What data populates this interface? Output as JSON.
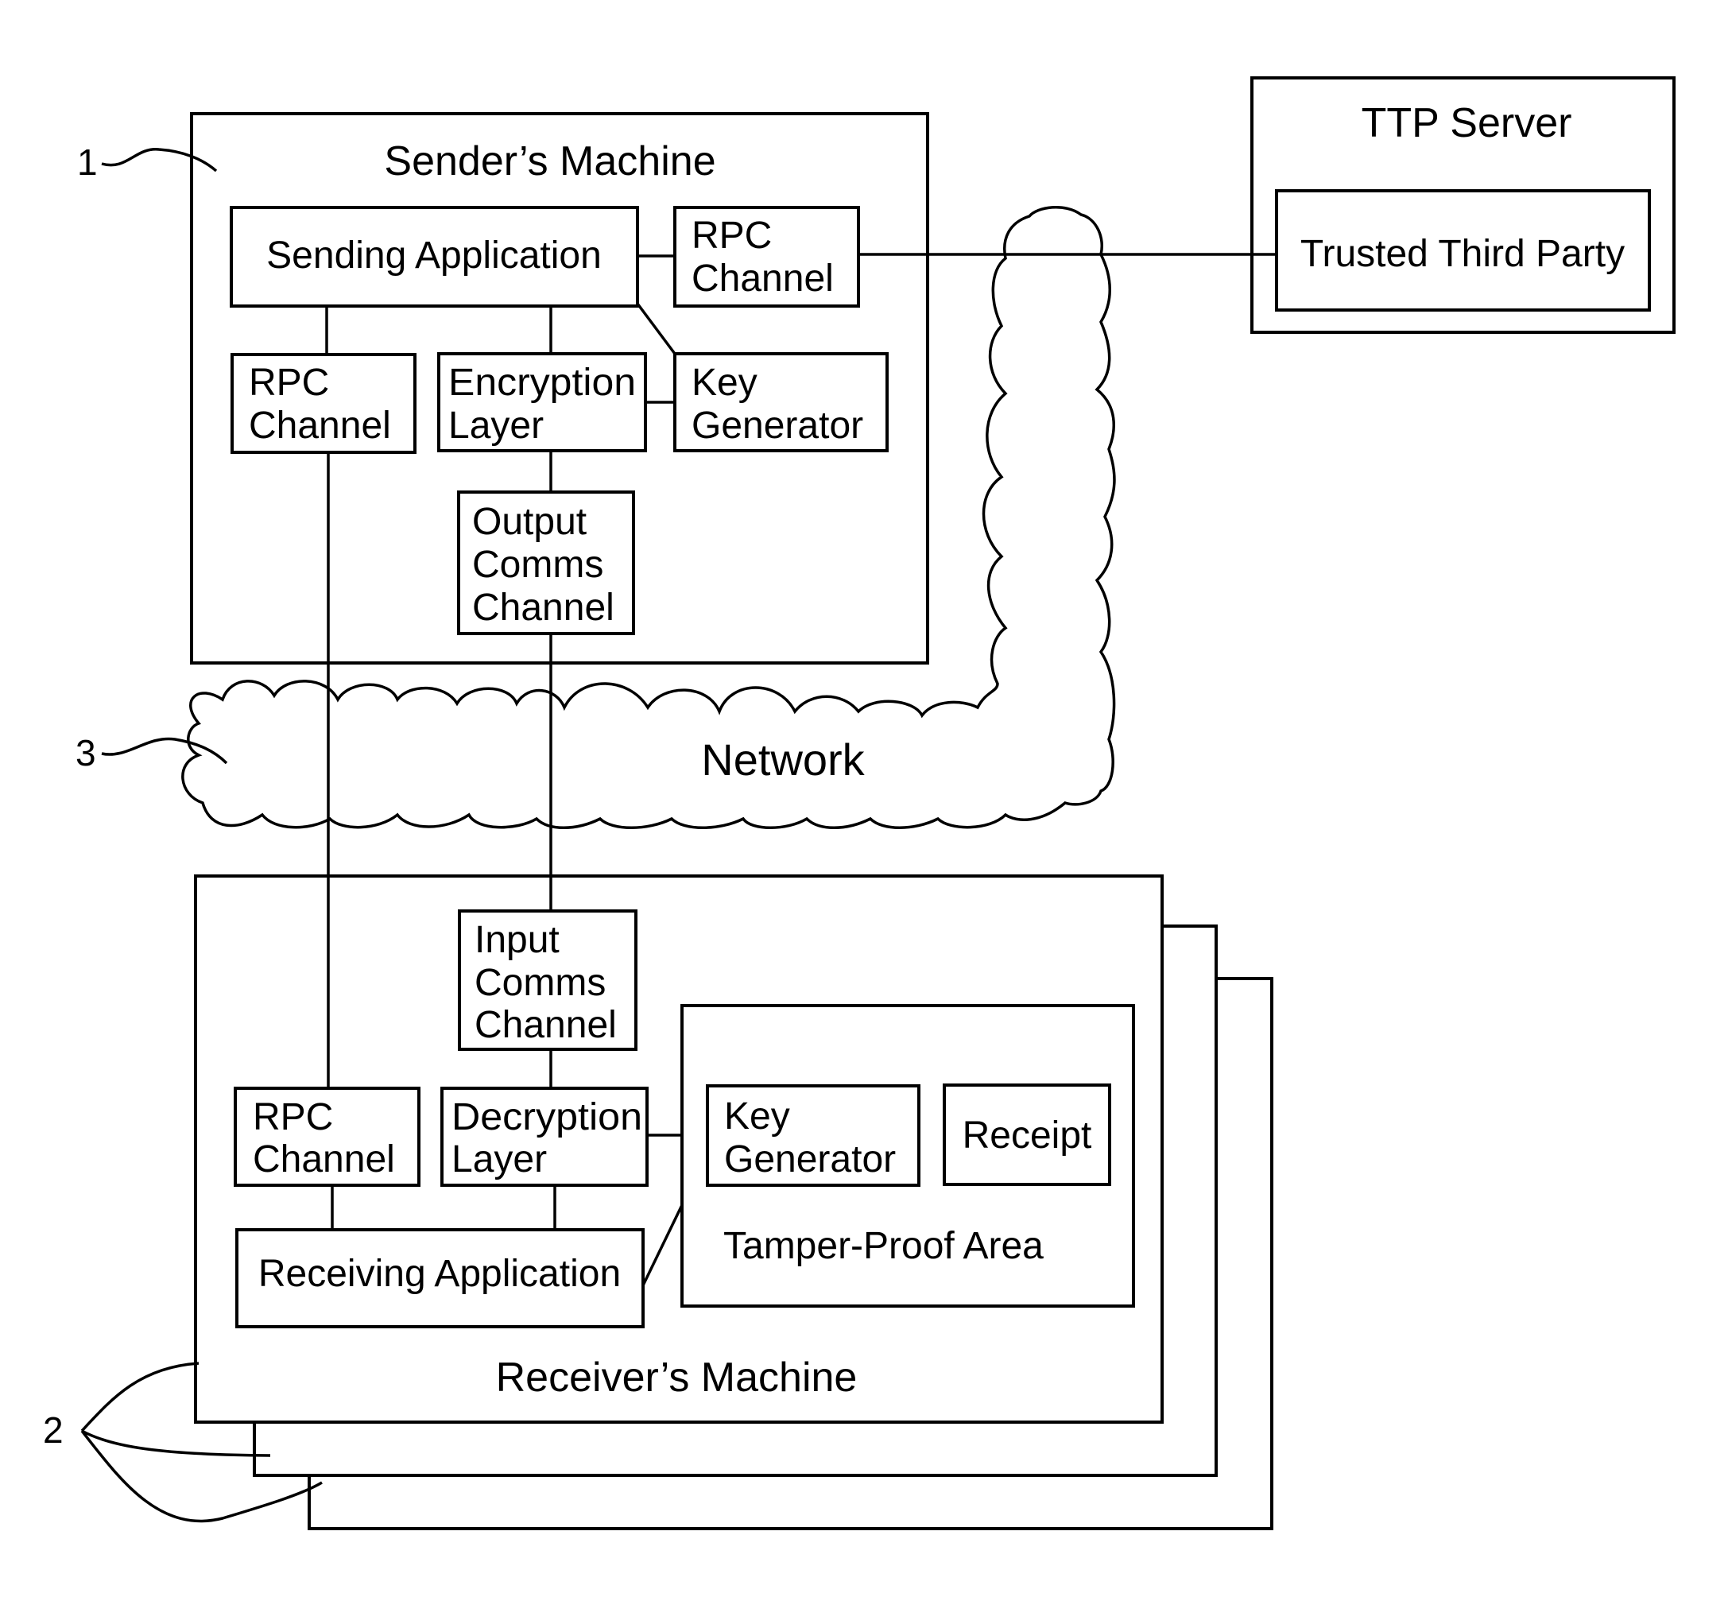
{
  "diagram": {
    "type": "block-diagram",
    "reference_numerals": {
      "sender": "1",
      "receivers": "2",
      "network": "3"
    },
    "sender_machine": {
      "title": "Sender’s Machine",
      "blocks": {
        "sending_application": "Sending Application",
        "rpc_channel_top_l1": "RPC",
        "rpc_channel_top_l2": "Channel",
        "rpc_channel_l1": "RPC",
        "rpc_channel_l2": "Channel",
        "encryption_l1": "Encryption",
        "encryption_l2": "Layer",
        "key_generator_l1": "Key",
        "key_generator_l2": "Generator",
        "output_l1": "Output",
        "output_l2": "Comms",
        "output_l3": "Channel"
      }
    },
    "ttp_server": {
      "title": "TTP Server",
      "trusted_third_party": "Trusted Third Party"
    },
    "network": {
      "label": "Network"
    },
    "receiver_machine": {
      "title": "Receiver’s Machine",
      "blocks": {
        "input_l1": "Input",
        "input_l2": "Comms",
        "input_l3": "Channel",
        "rpc_channel_l1": "RPC",
        "rpc_channel_l2": "Channel",
        "decryption_l1": "Decryption",
        "decryption_l2": "Layer",
        "receiving_application": "Receiving Application",
        "tamper_proof_area": "Tamper-Proof Area",
        "key_generator_l1": "Key",
        "key_generator_l2": "Generator",
        "receipt": "Receipt"
      }
    },
    "connections": [
      [
        "Sending Application",
        "RPC Channel (sender, top)"
      ],
      [
        "RPC Channel (sender, top)",
        "Trusted Third Party"
      ],
      [
        "Sending Application",
        "RPC Channel (sender)"
      ],
      [
        "Sending Application",
        "Encryption Layer"
      ],
      [
        "Sending Application",
        "Key Generator (sender)"
      ],
      [
        "Encryption Layer",
        "Key Generator (sender)"
      ],
      [
        "Encryption Layer",
        "Output Comms Channel"
      ],
      [
        "Output Comms Channel",
        "Input Comms Channel"
      ],
      [
        "RPC Channel (sender)",
        "RPC Channel (receiver)"
      ],
      [
        "Input Comms Channel",
        "Decryption Layer"
      ],
      [
        "Decryption Layer",
        "Key Generator (receiver)"
      ],
      [
        "Key Generator (receiver)",
        "Receipt"
      ],
      [
        "RPC Channel (receiver)",
        "Receiving Application"
      ],
      [
        "Decryption Layer",
        "Receiving Application"
      ],
      [
        "Receiving Application",
        "Key Generator (receiver)"
      ]
    ]
  }
}
